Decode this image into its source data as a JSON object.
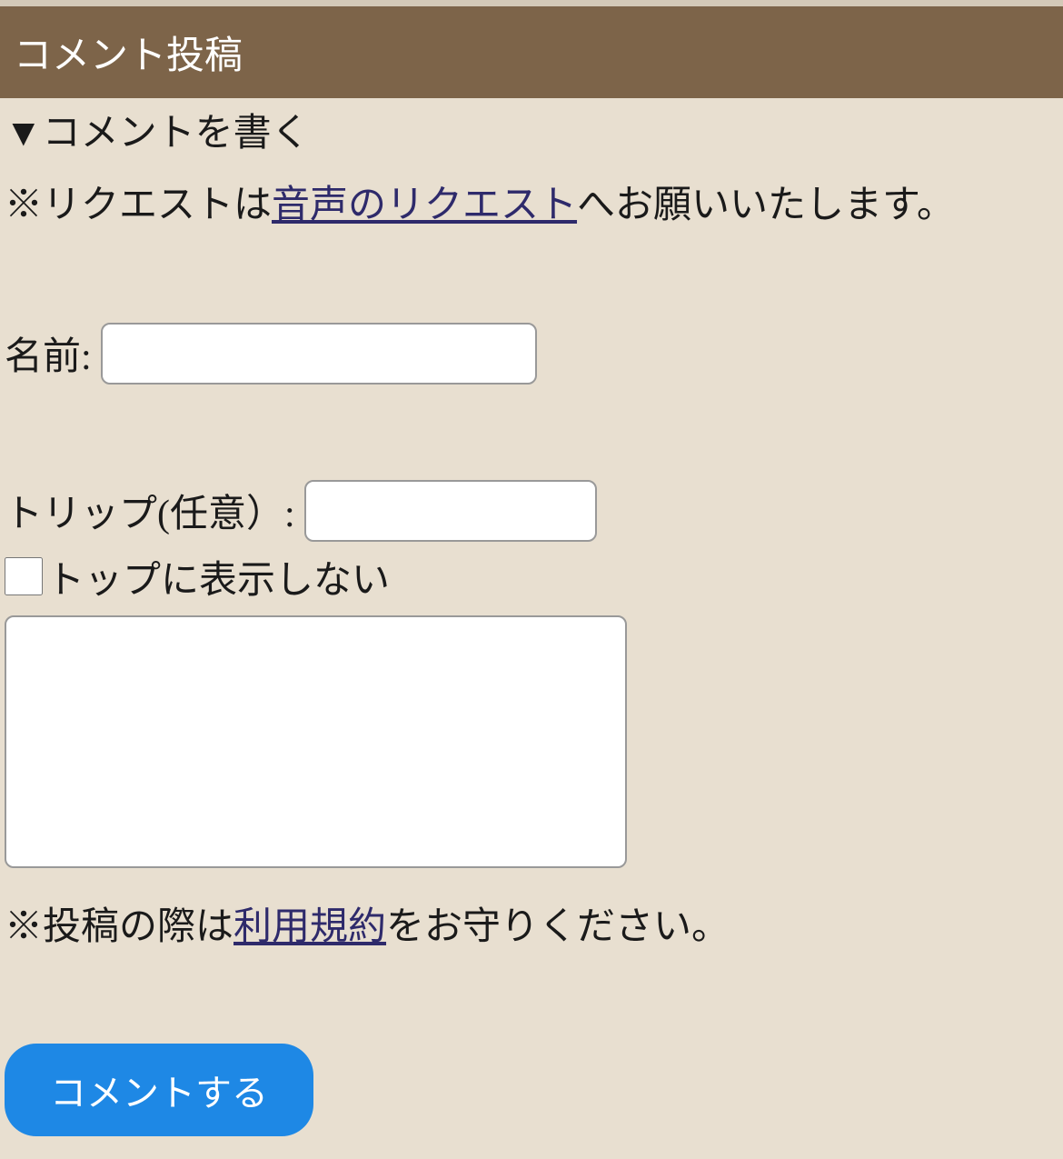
{
  "header": {
    "title": "コメント投稿"
  },
  "subtitle": "▼コメントを書く",
  "notice1": {
    "prefix": "※リクエストは",
    "link": "音声のリクエスト",
    "suffix": "へお願いいたします。"
  },
  "form": {
    "name_label": "名前:",
    "trip_label": "トリップ(任意）:",
    "checkbox_label": "トップに表示しない"
  },
  "notice2": {
    "prefix": "※投稿の際は",
    "link": "利用規約",
    "suffix": "をお守りください。"
  },
  "submit_label": "コメントする"
}
